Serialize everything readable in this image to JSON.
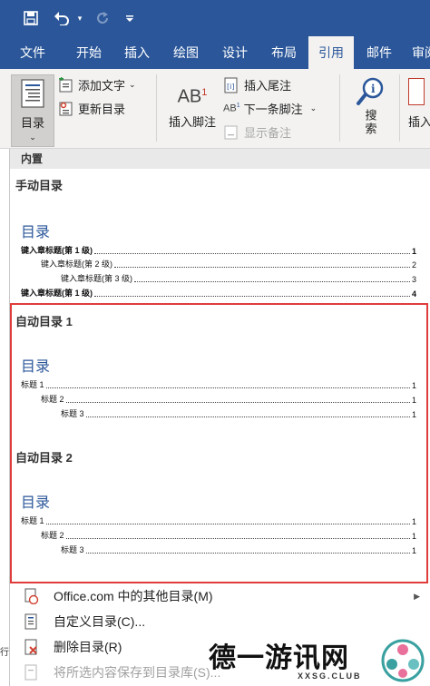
{
  "qat": {
    "save_icon": "save-icon",
    "undo_icon": "undo-icon",
    "redo_icon": "redo-icon",
    "customize_icon": "customize-qat-icon"
  },
  "tabs": [
    {
      "label": "文件",
      "active": false
    },
    {
      "label": "开始",
      "active": false
    },
    {
      "label": "插入",
      "active": false
    },
    {
      "label": "绘图",
      "active": false
    },
    {
      "label": "设计",
      "active": false
    },
    {
      "label": "布局",
      "active": false
    },
    {
      "label": "引用",
      "active": true
    },
    {
      "label": "邮件",
      "active": false
    },
    {
      "label": "审阅",
      "active": false
    }
  ],
  "ribbon": {
    "toc_button": "目录",
    "add_text": "添加文字",
    "update_toc": "更新目录",
    "insert_footnote": "插入脚注",
    "insert_endnote": "插入尾注",
    "next_footnote": "下一条脚注",
    "show_notes": "显示备注",
    "search": "搜索",
    "insert_partial": "插入"
  },
  "gallery": {
    "header": "内置",
    "manual": {
      "title": "手动目录",
      "toc_heading": "目录",
      "lines": [
        {
          "text": "键入章标题(第 1 级)",
          "page": "1",
          "level": 1,
          "bold": true
        },
        {
          "text": "键入章标题(第 2 级)",
          "page": "2",
          "level": 2,
          "bold": false
        },
        {
          "text": "键入章标题(第 3 级)",
          "page": "3",
          "level": 3,
          "bold": false
        },
        {
          "text": "键入章标题(第 1 级)",
          "page": "4",
          "level": 1,
          "bold": true
        }
      ]
    },
    "auto1": {
      "title": "自动目录 1",
      "toc_heading": "目录",
      "lines": [
        {
          "text": "标题 1",
          "page": "1",
          "level": 1
        },
        {
          "text": "标题 2",
          "page": "1",
          "level": 2
        },
        {
          "text": "标题 3",
          "page": "1",
          "level": 3
        }
      ]
    },
    "auto2": {
      "title": "自动目录 2",
      "toc_heading": "目录",
      "lines": [
        {
          "text": "标题 1",
          "page": "1",
          "level": 1
        },
        {
          "text": "标题 2",
          "page": "1",
          "level": 2
        },
        {
          "text": "标题 3",
          "page": "1",
          "level": 3
        }
      ]
    }
  },
  "menu": {
    "more_toc": "Office.com 中的其他目录(M)",
    "custom_toc": "自定义目录(C)...",
    "remove_toc": "删除目录(R)",
    "save_selection": "将所选内容保存到目录库(S)..."
  },
  "watermark": {
    "text": "德一游讯网",
    "sub": "XXSG.CLUB"
  },
  "edge_text": "行"
}
